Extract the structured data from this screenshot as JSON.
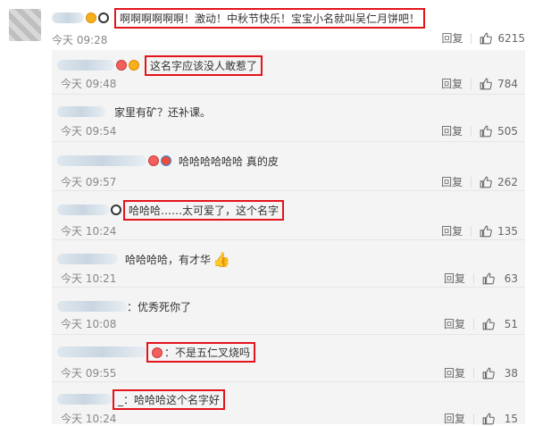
{
  "top_comment": {
    "content": "啊啊啊啊啊啊！激动！中秋节快乐！宝宝小名就叫吴仁月饼吧！",
    "time": "今天 09:28",
    "reply_label": "回复",
    "likes": "6215"
  },
  "replies": [
    {
      "content": "这名字应该没人敢惹了",
      "time": "今天 09:48",
      "reply_label": "回复",
      "likes": "784",
      "highlight": true
    },
    {
      "content": "家里有矿？还补课。",
      "time": "今天 09:54",
      "reply_label": "回复",
      "likes": "505",
      "highlight": false
    },
    {
      "content": "哈哈哈哈哈哈 真的皮",
      "time": "今天 09:57",
      "reply_label": "回复",
      "likes": "262",
      "highlight": false
    },
    {
      "content": "哈哈哈……太可爱了，这个名字",
      "time": "今天 10:24",
      "reply_label": "回复",
      "likes": "135",
      "highlight": true
    },
    {
      "content": "哈哈哈哈，有才华",
      "time": "今天 10:21",
      "reply_label": "回复",
      "likes": "63",
      "highlight": false
    },
    {
      "content": "：优秀死你了",
      "time": "今天 10:08",
      "reply_label": "回复",
      "likes": "51",
      "highlight": false
    },
    {
      "content": "：不是五仁叉烧吗",
      "time": "今天 09:55",
      "reply_label": "回复",
      "likes": "38",
      "highlight": true
    },
    {
      "content": "：哈哈哈这个名字好",
      "time": "今天 10:24",
      "reply_label": "回复",
      "likes": "15",
      "highlight": true
    }
  ],
  "icons": {
    "like": "thumbs-up-icon",
    "thumb_emoji": "👍"
  }
}
